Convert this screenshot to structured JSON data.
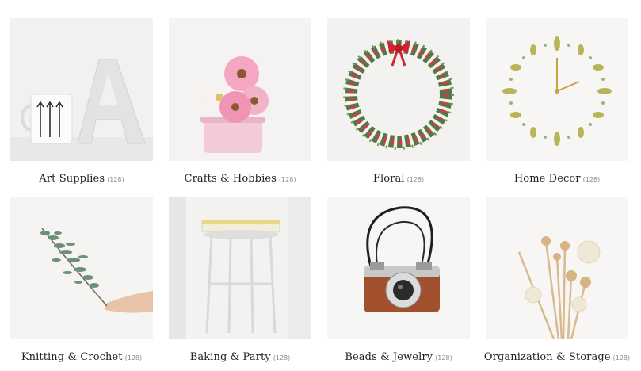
{
  "categories": [
    {
      "name": "Art Supplies",
      "count": "(128)",
      "image": "mug-and-letter-a"
    },
    {
      "name": "Crafts & Hobbies",
      "count": "(128)",
      "image": "pink-flowers-in-pot"
    },
    {
      "name": "Floral",
      "count": "(128)",
      "image": "berry-wreath"
    },
    {
      "name": "Home Decor",
      "count": "(128)",
      "image": "leaf-clock"
    },
    {
      "name": "Knitting & Crochet",
      "count": "(128)",
      "image": "eucalyptus-branch-in-hand"
    },
    {
      "name": "Baking & Party",
      "count": "(128)",
      "image": "white-stool-with-book"
    },
    {
      "name": "Beads & Jewelry",
      "count": "(128)",
      "image": "vintage-camera"
    },
    {
      "name": "Organization & Storage",
      "count": "(128)",
      "image": "reed-diffuser-sticks"
    }
  ]
}
